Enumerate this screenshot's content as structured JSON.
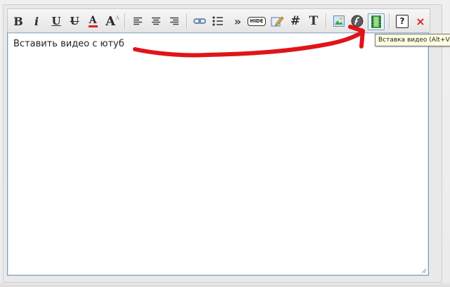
{
  "editor": {
    "content": "Вставить видео с ютуб"
  },
  "toolbar": {
    "bold": "B",
    "italic": "i",
    "underline": "U",
    "strikethrough": "U",
    "font_color": "A",
    "font_size": "A",
    "hide": "HIDE",
    "hash": "#",
    "text": "T",
    "help": "?",
    "close": "×"
  },
  "tooltip": {
    "text": "Вставка видео (Alt+V)"
  },
  "colors": {
    "accent_red": "#e0141a",
    "font_color_bar": "#d9251c",
    "video_icon": "#3a9a3a",
    "editor_border": "#7f9db9"
  },
  "icons": {
    "align_left": "align-left-icon",
    "align_center": "align-center-icon",
    "align_right": "align-right-icon",
    "link": "link-icon",
    "list": "bullet-list-icon",
    "quote": "quote-icon",
    "hide": "hide-icon",
    "edit": "pencil-icon",
    "image": "image-icon",
    "flash": "flash-icon",
    "video": "film-icon",
    "help": "help-icon",
    "close": "close-icon"
  }
}
